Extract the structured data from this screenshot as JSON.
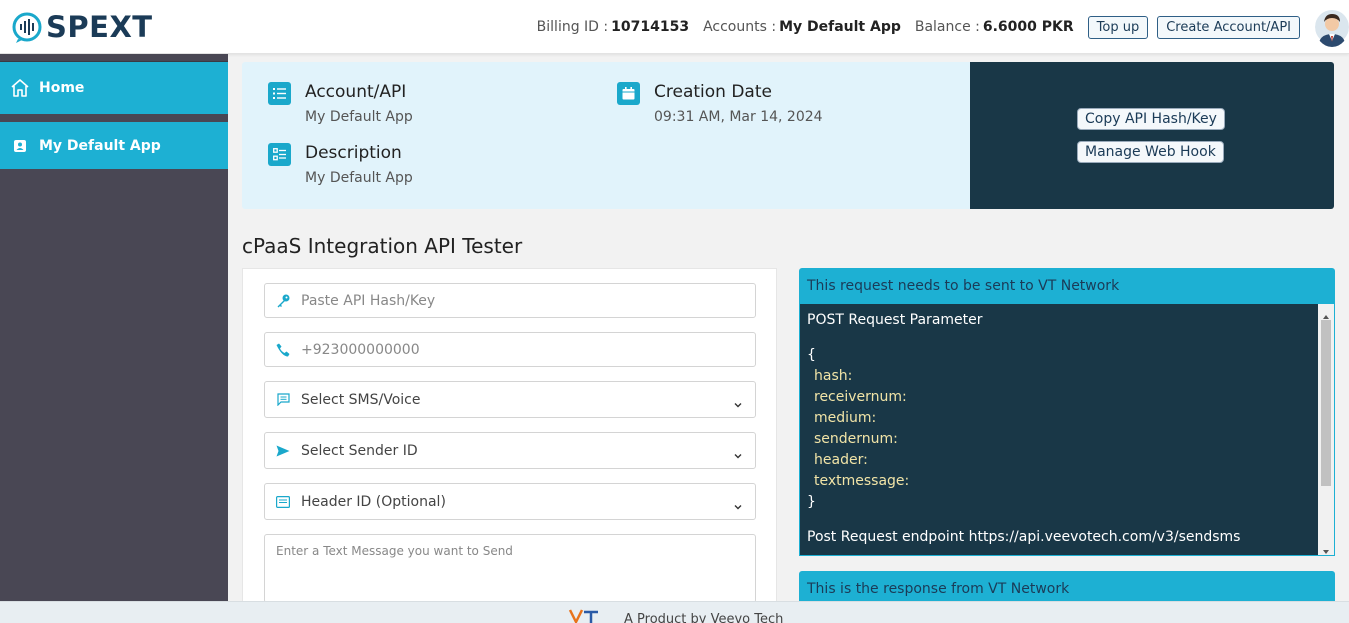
{
  "header": {
    "logo_text": "SPEXT",
    "billing_label": "Billing ID :",
    "billing_id": "10714153",
    "accounts_label": "Accounts :",
    "accounts_value": "My Default App",
    "balance_label": "Balance :",
    "balance_value": "6.6000 PKR",
    "top_up_label": "Top up",
    "create_account_label": "Create Account/API"
  },
  "sidebar": {
    "items": [
      {
        "label": "Home",
        "icon": "home-icon"
      },
      {
        "label": "My Default App",
        "icon": "contact-card-icon"
      }
    ]
  },
  "info": {
    "account_title": "Account/API",
    "account_value": "My Default App",
    "description_title": "Description",
    "description_value": "My Default App",
    "creation_title": "Creation Date",
    "creation_value": "09:31 AM, Mar 14, 2024",
    "copy_button": "Copy API Hash/Key",
    "webhook_button": "Manage Web Hook"
  },
  "tester": {
    "title": "cPaaS Integration API Tester",
    "hash_placeholder": "Paste API Hash/Key",
    "phone_placeholder": "+923000000000",
    "medium_select": "Select SMS/Voice",
    "sender_select": "Select Sender ID",
    "header_select": "Header ID (Optional)",
    "message_placeholder": "Enter a Text Message you want to Send"
  },
  "request": {
    "heading": "This request needs to be sent to VT Network",
    "param_title": "POST Request Parameter",
    "open_brace": "{",
    "keys": [
      "hash:",
      "receivernum:",
      "medium:",
      "sendernum:",
      "header:",
      "textmessage:"
    ],
    "close_brace": "}",
    "endpoint": "Post Request endpoint https://api.veevotech.com/v3/sendsms"
  },
  "response": {
    "heading": "This is the response from VT Network"
  },
  "footer": {
    "text": "A Product by Veevo Tech"
  },
  "colors": {
    "accent": "#1db0d3",
    "dark": "#193747",
    "sidebar": "#494754",
    "info_bg": "#e1f3fb"
  }
}
